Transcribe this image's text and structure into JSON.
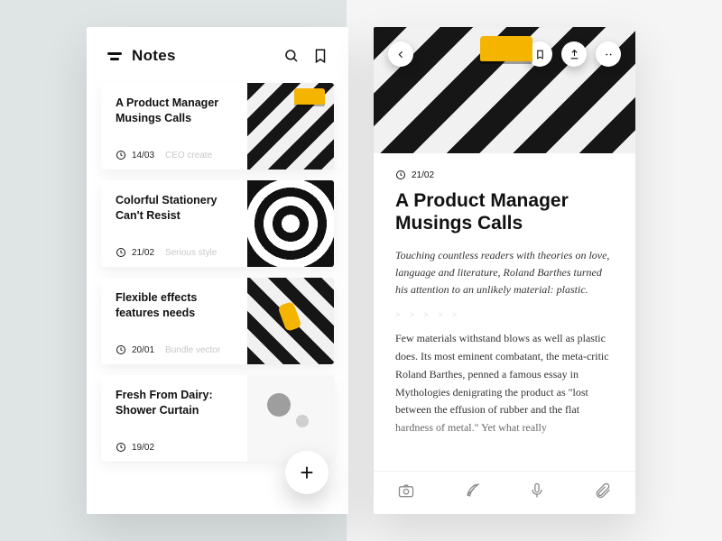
{
  "list": {
    "title": "Notes",
    "items": [
      {
        "title": "A Product Manager Musings Calls",
        "date": "14/03",
        "tag": "CEO create",
        "thumb": "chevron"
      },
      {
        "title": "Colorful Stationery Can't Resist",
        "date": "21/02",
        "tag": "Serious style",
        "thumb": "swirl"
      },
      {
        "title": "Flexible effects features needs",
        "date": "20/01",
        "tag": "Bundle vector",
        "thumb": "runner"
      },
      {
        "title": "Fresh From Dairy: Shower Curtain",
        "date": "19/02",
        "tag": "",
        "thumb": "dots"
      }
    ]
  },
  "detail": {
    "date": "21/02",
    "title": "A Product Manager Musings Calls",
    "lede": "Touching countless readers with theories on love, language and literature, Roland Barthes turned his attention to an unlikely material: plastic.",
    "divider": "> > > > >",
    "body": "Few materials withstand blows as well as plastic does. Its most eminent combatant, the meta-critic Roland Barthes, penned a famous essay in Mythologies denigrating the product as \"lost between the effusion of rubber and the flat hardness of metal.\" Yet what really"
  }
}
